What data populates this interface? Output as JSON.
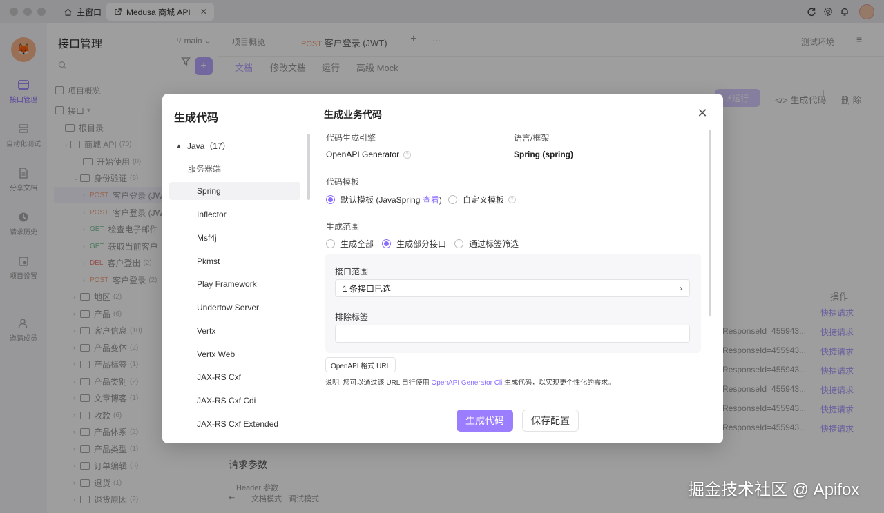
{
  "titlebar": {
    "tabs": [
      {
        "label": "主窗口",
        "icon": "home-icon"
      },
      {
        "label": "Medusa 商城 API",
        "icon": "link-icon"
      }
    ]
  },
  "rail": {
    "items": [
      {
        "label": "接口管理",
        "icon": "api-icon"
      },
      {
        "label": "自动化测试",
        "icon": "test-icon"
      },
      {
        "label": "分享文档",
        "icon": "doc-icon"
      },
      {
        "label": "请求历史",
        "icon": "history-icon"
      },
      {
        "label": "项目设置",
        "icon": "settings-icon"
      },
      {
        "label": "邀请成员",
        "icon": "user-add-icon"
      }
    ]
  },
  "sidebar": {
    "title": "接口管理",
    "overview": "项目概览",
    "api_root": "接口",
    "tree": [
      {
        "label": "根目录",
        "count": ""
      },
      {
        "label": "商城 API",
        "count": "(70)"
      },
      {
        "label": "开始使用",
        "count": "(0)"
      },
      {
        "label": "身份验证",
        "count": "(6)"
      },
      {
        "method": "POST",
        "label": "客户登录 (JW",
        "count": ""
      },
      {
        "method": "POST",
        "label": "客户登录 (JW",
        "count": ""
      },
      {
        "method": "GET",
        "label": "检查电子邮件",
        "count": ""
      },
      {
        "method": "GET",
        "label": "获取当前客户",
        "count": ""
      },
      {
        "method": "DEL",
        "label": "客户登出",
        "count": "(2)"
      },
      {
        "method": "POST",
        "label": "客户登录",
        "count": "(2)"
      },
      {
        "label": "地区",
        "count": "(2)"
      },
      {
        "label": "产品",
        "count": "(6)"
      },
      {
        "label": "客户信息",
        "count": "(10)"
      },
      {
        "label": "产品变体",
        "count": "(2)"
      },
      {
        "label": "产品标签",
        "count": "(1)"
      },
      {
        "label": "产品类别",
        "count": "(2)"
      },
      {
        "label": "文章博客",
        "count": "(1)"
      },
      {
        "label": "收款",
        "count": "(6)"
      },
      {
        "label": "产品体系",
        "count": "(2)"
      },
      {
        "label": "产品类型",
        "count": "(1)"
      },
      {
        "label": "订单编辑",
        "count": "(3)"
      },
      {
        "label": "退货",
        "count": "(1)"
      },
      {
        "label": "退货原因",
        "count": "(2)"
      }
    ]
  },
  "main": {
    "branch": "main",
    "overview_tab": "项目概览",
    "tab_method": "POST",
    "tab_title": "客户登录 (JWT)",
    "env": "测试环境",
    "subtabs": [
      "文档",
      "修改文档",
      "运行",
      "高级 Mock"
    ],
    "run": "运行",
    "gen_code": "生成代码",
    "delete": "删 除",
    "ops_header": "操作",
    "quick_req": "快捷请求",
    "response_id": "ResponseId=455943...",
    "req_params": "请求参数",
    "header_params": "Header 参数",
    "doc_mode": "文档模式",
    "debug_mode": "调试模式"
  },
  "modal": {
    "left_title": "生成代码",
    "lang": "Java",
    "lang_count": "（17）",
    "group": "服务器端",
    "frameworks": [
      "Spring",
      "Inflector",
      "Msf4j",
      "Pkmst",
      "Play Framework",
      "Undertow Server",
      "Vertx",
      "Vertx Web",
      "JAX-RS Cxf",
      "JAX-RS Cxf Cdi",
      "JAX-RS Cxf Extended"
    ],
    "right_title": "生成业务代码",
    "engine_label": "代码生成引擎",
    "engine_value": "OpenAPI Generator",
    "lang_label": "语言/框架",
    "lang_value": "Spring (spring)",
    "template_label": "代码模板",
    "template_default": "默认模板 (JavaSpring",
    "template_view": "查看",
    "template_close": ")",
    "template_custom": "自定义模板",
    "scope_label": "生成范围",
    "scope_all": "生成全部",
    "scope_part": "生成部分接口",
    "scope_tag": "通过标签筛选",
    "api_scope_label": "接口范围",
    "api_scope_value": "1 条接口已选",
    "exclude_tags_label": "排除标签",
    "url_tag": "OpenAPI 格式 URL",
    "note_prefix": "说明: 您可以通过该 URL 自行使用",
    "note_link": "OpenAPI Generator Cli",
    "note_suffix": "生成代码，以实现更个性化的需求。",
    "btn_generate": "生成代码",
    "btn_save": "保存配置"
  },
  "watermark": "掘金技术社区 @ Apifox"
}
